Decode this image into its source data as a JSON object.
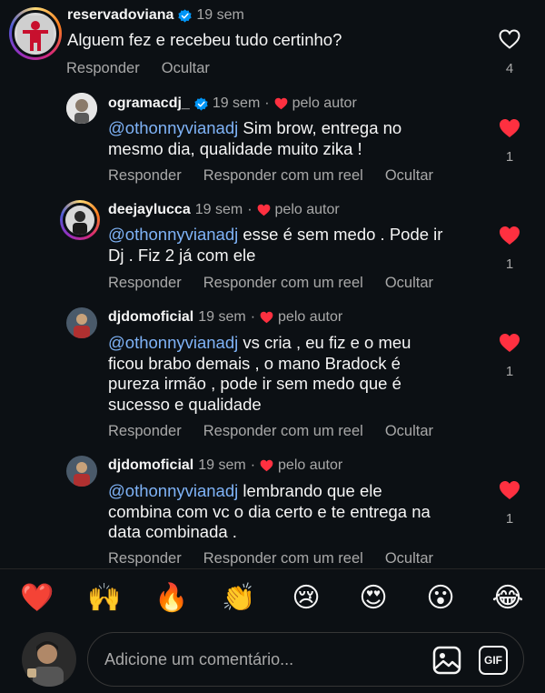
{
  "thread": {
    "top_comment": {
      "username": "reservadoviana",
      "time": "19 sem",
      "text": "Alguem fez e recebeu tudo certinho?",
      "actions": [
        "Responder",
        "Ocultar"
      ],
      "likes": "4"
    },
    "replies": [
      {
        "username": "ogramacdj_",
        "verified": true,
        "time": "19 sem",
        "badge": "pelo autor",
        "mention": "@othonnyvianadj",
        "lines": [
          " Sim brow, entrega no",
          "mesmo dia, qualidade muito zika !"
        ],
        "actions": [
          "Responder",
          "Responder com um reel",
          "Ocultar"
        ],
        "likes": "1"
      },
      {
        "username": "deejaylucca",
        "verified": false,
        "time": "19 sem",
        "badge": "pelo autor",
        "mention": "@othonnyvianadj",
        "lines": [
          " esse é sem medo . Pode ir",
          "Dj . Fiz 2 já com ele"
        ],
        "actions": [
          "Responder",
          "Responder com um reel",
          "Ocultar"
        ],
        "likes": "1"
      },
      {
        "username": "djdomoficial",
        "verified": false,
        "time": "19 sem",
        "badge": "pelo autor",
        "mention": "@othonnyvianadj",
        "lines": [
          " vs cria , eu fiz e o meu",
          "ficou brabo demais , o mano Bradock é",
          "pureza irmão , pode ir sem medo que é",
          "sucesso e qualidade"
        ],
        "actions": [
          "Responder",
          "Responder com um reel",
          "Ocultar"
        ],
        "likes": "1"
      },
      {
        "username": "djdomoficial",
        "verified": false,
        "time": "19 sem",
        "badge": "pelo autor",
        "mention": "@othonnyvianadj",
        "lines": [
          " lembrando que ele",
          "combina com vc o dia certo e te entrega na",
          "data combinada ."
        ],
        "actions": [
          "Responder",
          "Responder com um reel",
          "Ocultar"
        ],
        "likes": "1"
      }
    ]
  },
  "emoji_bar": [
    "❤️",
    "🙌",
    "🔥",
    "👏",
    "😢",
    "😍",
    "😮",
    "😂"
  ],
  "composer": {
    "placeholder": "Adicione um comentário...",
    "gif_label": "GIF"
  },
  "colors": {
    "background": "#0c1014",
    "mention": "#7fb3f7",
    "heart": "#ff3040",
    "verified": "#0095f6",
    "muted": "#a8a8a8"
  },
  "icons": [
    "heart-outline-icon",
    "heart-filled-icon",
    "verified-badge-icon",
    "image-icon",
    "gif-icon"
  ]
}
